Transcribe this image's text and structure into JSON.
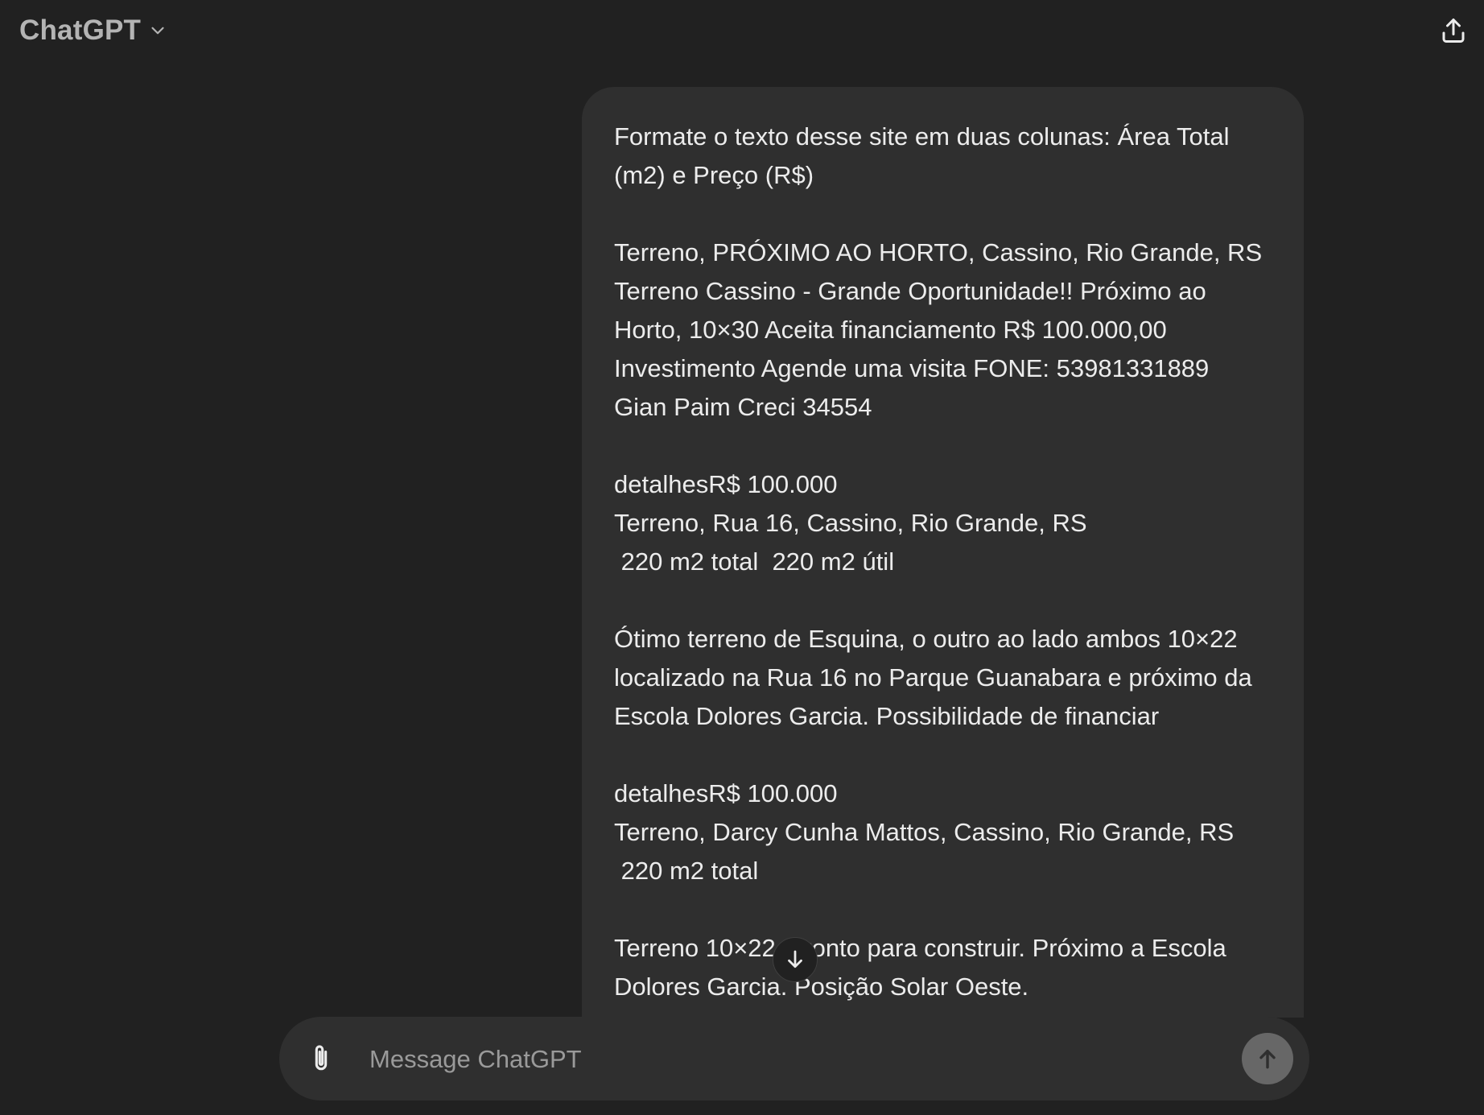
{
  "header": {
    "model_name": "ChatGPT",
    "model_dropdown_icon": "chevron-down-icon",
    "share_icon": "share-upload-icon"
  },
  "conversation": {
    "user_message_lines": [
      "Formate o texto desse site em duas colunas: Área Total",
      "(m2) e Preço (R$)",
      "",
      "Terreno, PRÓXIMO AO HORTO, Cassino, Rio Grande, RS",
      "Terreno Cassino - Grande Oportunidade!! Próximo ao",
      "Horto, 10×30 Aceita financiamento R$ 100.000,00",
      "Investimento Agende uma visita FONE: 53981331889",
      "Gian Paim Creci 34554",
      "",
      "detalhesR$ 100.000",
      "Terreno, Rua 16, Cassino, Rio Grande, RS",
      " 220 m2 total  220 m2 útil",
      "",
      "Ótimo terreno de Esquina, o outro ao lado ambos 10×22",
      "localizado na Rua 16 no Parque Guanabara e próximo da",
      "Escola Dolores Garcia. Possibilidade de financiar",
      "",
      "detalhesR$ 100.000",
      "Terreno, Darcy Cunha Mattos, Cassino, Rio Grande, RS",
      " 220 m2 total",
      "",
      "Terreno 10×22, pronto para construir. Próximo a Escola",
      "Dolores Garcia. Posição Solar Oeste."
    ],
    "scroll_down_icon": "arrow-down-icon"
  },
  "composer": {
    "placeholder": "Message ChatGPT",
    "value": "",
    "attach_icon": "paperclip-icon",
    "send_icon": "arrow-up-icon"
  },
  "colors": {
    "background": "#212121",
    "bubble": "#2f2f2f",
    "text": "#ececec",
    "muted_text": "#b4b4b4",
    "send_button": "#676767"
  }
}
